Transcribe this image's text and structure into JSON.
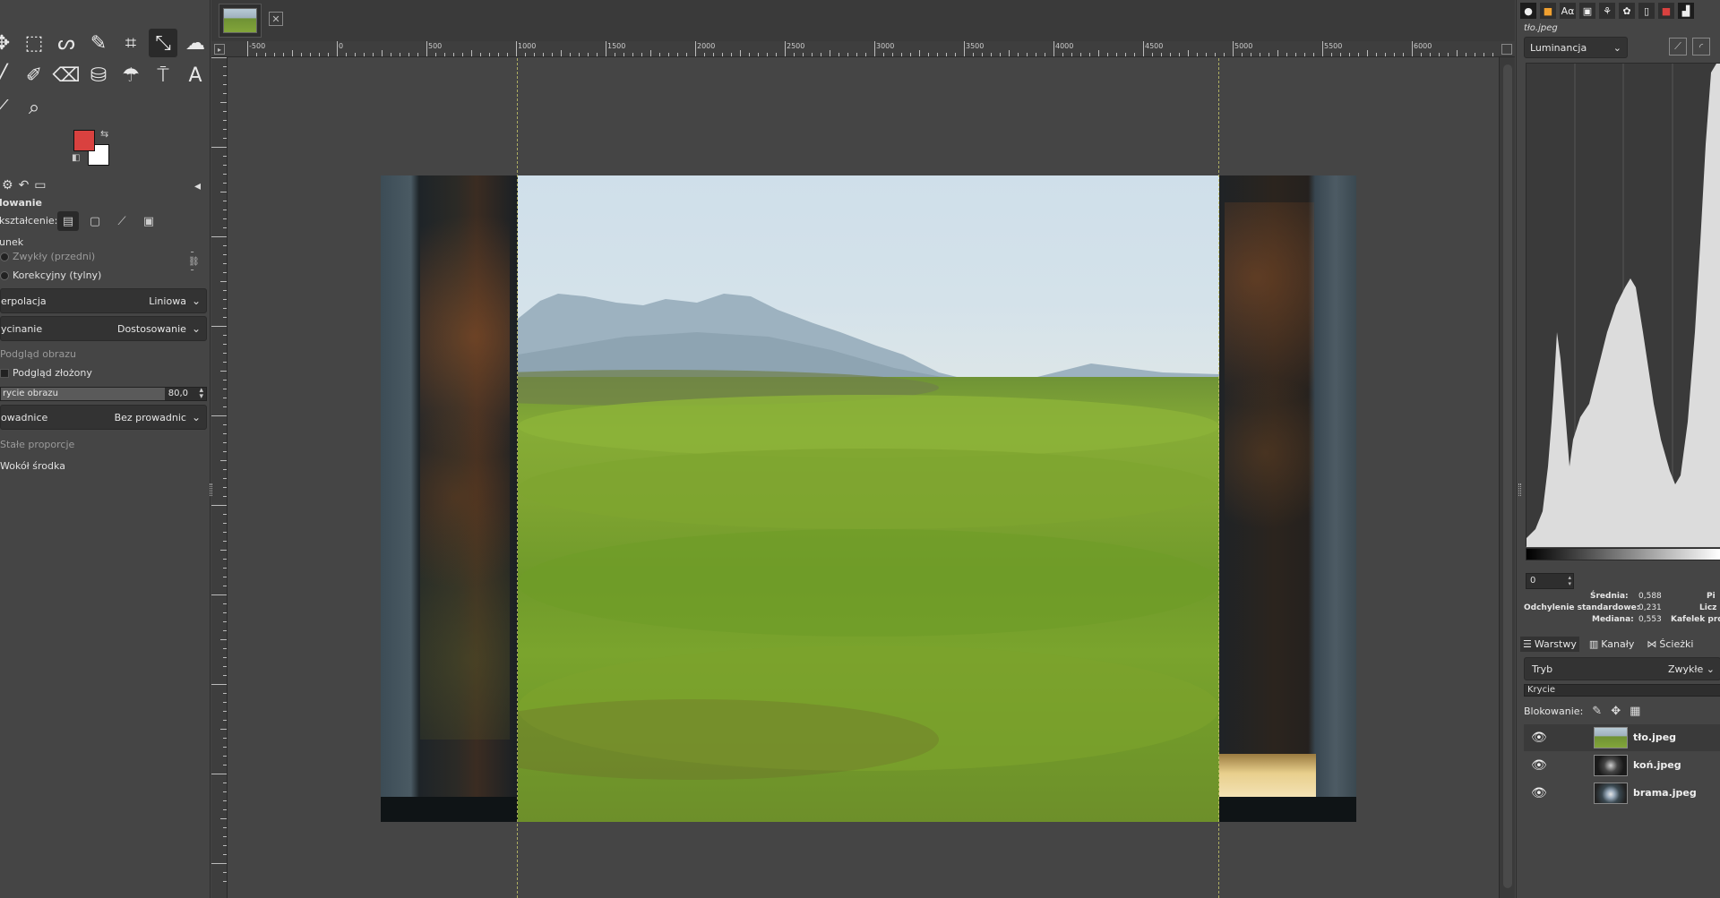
{
  "window": {
    "colors": {
      "bg": "#454545",
      "panel_dark": "#333333",
      "fg_color": "#d9413f",
      "bg_color": "#ffffff"
    }
  },
  "toolbox": {
    "tools_row1": [
      "move-tool",
      "rect-select-tool",
      "lasso-tool",
      "fuzzy-select-tool",
      "crop-tool",
      "unified-transform-tool",
      "warp-tool"
    ],
    "tools_row2": [
      "paintbrush-tool",
      "pencil-tool",
      "eraser-tool",
      "clone-tool",
      "smudge-tool",
      "paths-tool",
      "text-tool"
    ],
    "tools_row3": [
      "color-picker-tool",
      "zoom-tool"
    ],
    "text_tool_glyph": "A"
  },
  "tool_options": {
    "title": "lowanie",
    "transform_label": "kształcenie:",
    "direction_label": "unek",
    "direction_forward": "Zwykły (przedni)",
    "direction_backward": "Korekcyjny (tylny)",
    "interpolation_label": "erpolacja",
    "interpolation_value": "Liniowa",
    "clipping_label": "ycinanie",
    "clipping_value": "Dostosowanie",
    "preview_label": "Podgląd obrazu",
    "composite_preview": "Podgląd złożony",
    "opacity_label": "rycie obrazu",
    "opacity_value": "80,0",
    "opacity_fraction": 0.8,
    "guides_label": "owadnice",
    "guides_value": "Bez prowadnic",
    "constrain_label": "Stałe proporcje",
    "center_label": "Wokół środka"
  },
  "ruler": {
    "labels": [
      "-500",
      "0",
      "500",
      "1000",
      "1500",
      "2000",
      "2500",
      "3000",
      "3500",
      "4000",
      "4500",
      "5000",
      "5500",
      "6000"
    ]
  },
  "histogram": {
    "image_name": "tło.jpeg",
    "channel": "Luminancja",
    "range_start": "0",
    "stats": {
      "mean_label": "Średnia:",
      "mean_value": "0,588",
      "std_label": "Odchylenie standardowe:",
      "std_value": "0,231",
      "median_label": "Mediana:",
      "median_value": "0,553",
      "pixels_label": "Pi",
      "count_label": "Licz",
      "percentile_label": "Kafelek proc"
    }
  },
  "layers_panel": {
    "tabs": [
      "Warstwy",
      "Kanały",
      "Ścieżki"
    ],
    "mode_label": "Tryb",
    "mode_value": "Zwykłe",
    "opacity_label": "Krycie",
    "lock_label": "Blokowanie:",
    "layers": [
      {
        "name": "tło.jpeg",
        "active": true
      },
      {
        "name": "koń.jpeg",
        "active": false
      },
      {
        "name": "brama.jpeg",
        "active": false
      }
    ]
  }
}
